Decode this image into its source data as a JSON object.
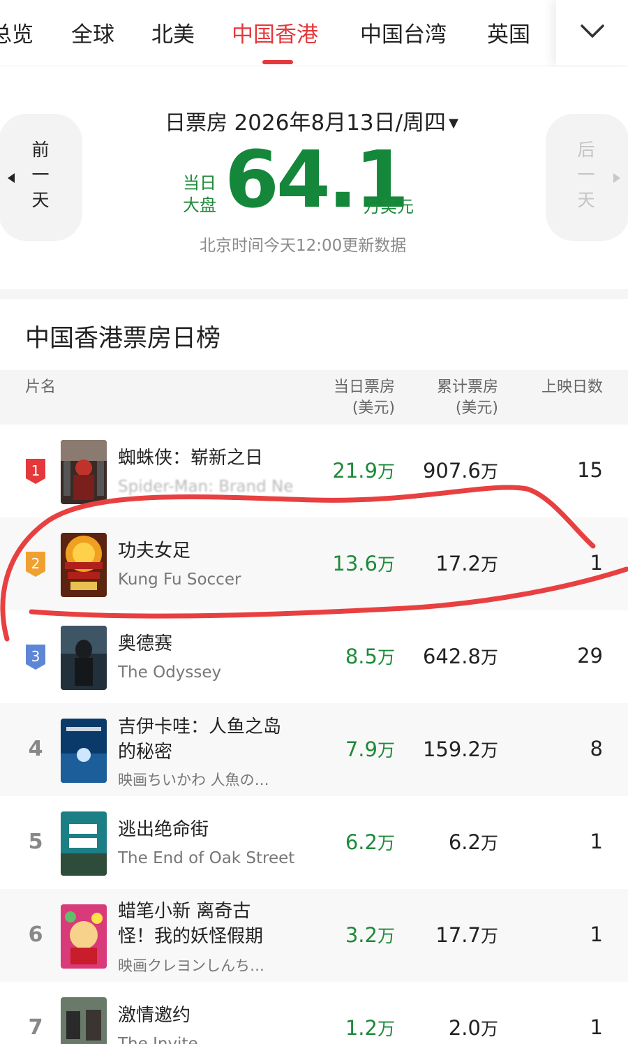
{
  "tabs": [
    {
      "label": "总览",
      "active": false
    },
    {
      "label": "全球",
      "active": false
    },
    {
      "label": "北美",
      "active": false
    },
    {
      "label": "中国香港",
      "active": true
    },
    {
      "label": "中国台湾",
      "active": false
    },
    {
      "label": "英国",
      "active": false
    }
  ],
  "summary": {
    "prev_day": [
      "前",
      "一",
      "天"
    ],
    "next_day": [
      "后",
      "一",
      "天"
    ],
    "date_label": "日票房",
    "date_value": "2026年8月13日/周四",
    "dropdown_caret": "▼",
    "big_label_1": "当日",
    "big_label_2": "大盘",
    "big_value": "64.1",
    "big_unit": "万美元",
    "update_note": "北京时间今天12:00更新数据"
  },
  "ranking": {
    "title": "中国香港票房日榜",
    "headers": {
      "name": "片名",
      "day_box": "当日票房",
      "day_box_unit": "(美元)",
      "total_box": "累计票房",
      "total_box_unit": "(美元)",
      "days": "上映日数"
    },
    "unit": "万",
    "rows": [
      {
        "rank": "1",
        "name": "蜘蛛侠：崭新之日",
        "sub": "Spider-Man: Brand New Day",
        "day": "21.9",
        "total": "907.6",
        "days": "15"
      },
      {
        "rank": "2",
        "name": "功夫女足",
        "sub": "Kung Fu Soccer",
        "day": "13.6",
        "total": "17.2",
        "days": "1"
      },
      {
        "rank": "3",
        "name": "奥德赛",
        "sub": "The Odyssey",
        "day": "8.5",
        "total": "642.8",
        "days": "29"
      },
      {
        "rank": "4",
        "name": "吉伊卡哇：人鱼之岛的秘密",
        "sub": "映画ちいかわ 人魚の…",
        "day": "7.9",
        "total": "159.2",
        "days": "8"
      },
      {
        "rank": "5",
        "name": "逃出绝命街",
        "sub": "The End of Oak Street",
        "day": "6.2",
        "total": "6.2",
        "days": "1"
      },
      {
        "rank": "6",
        "name": "蜡笔小新 离奇古怪！我的妖怪假期",
        "sub": "映画クレヨンしんち…",
        "day": "3.2",
        "total": "17.7",
        "days": "1"
      },
      {
        "rank": "7",
        "name": "激情邀约",
        "sub": "The Invite",
        "day": "1.2",
        "total": "2.0",
        "days": "1"
      }
    ]
  },
  "colors": {
    "accent_red": "#e5383b",
    "green": "#1e8a3a",
    "badge_gold": "#f0a030",
    "badge_blue": "#5d86d6",
    "scribble": "#e84040"
  }
}
